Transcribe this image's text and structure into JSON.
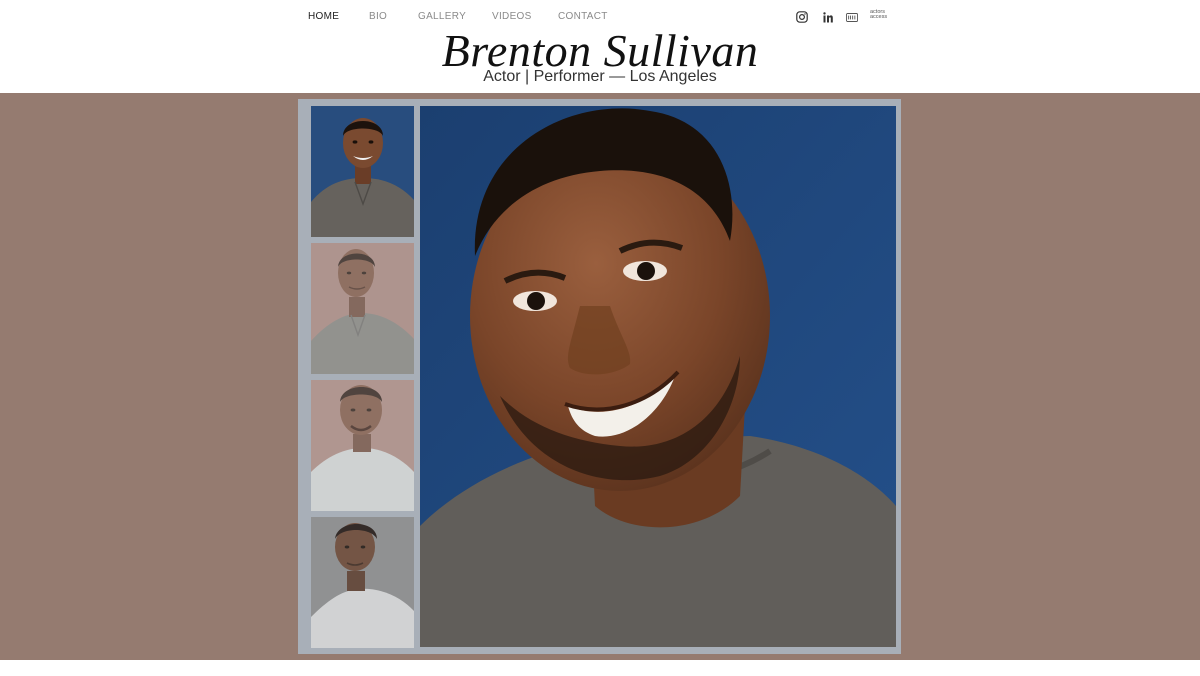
{
  "nav": {
    "items": [
      {
        "label": "HOME",
        "active": true
      },
      {
        "label": "BIO",
        "active": false
      },
      {
        "label": "GALLERY",
        "active": false
      },
      {
        "label": "VIDEOS",
        "active": false
      },
      {
        "label": "CONTACT",
        "active": false
      }
    ],
    "social": [
      {
        "icon": "instagram-icon"
      },
      {
        "icon": "linkedin-icon"
      },
      {
        "icon": "imdb-icon"
      },
      {
        "icon": "actors-access-icon",
        "text": "actors access"
      }
    ]
  },
  "header": {
    "title": "Brenton Sullivan",
    "subtitle": "Actor | Performer — Los Angeles"
  },
  "colors": {
    "band": "#957b70",
    "frame": "#a8afb8",
    "headshot_background": "#1f4678"
  },
  "gallery": {
    "thumbnails": [
      {
        "backdrop": "blue",
        "shirt": "grey henley",
        "selected": true
      },
      {
        "backdrop": "pink",
        "shirt": "grey henley",
        "selected": false
      },
      {
        "backdrop": "pink",
        "shirt": "white tee",
        "selected": false
      },
      {
        "backdrop": "grey",
        "shirt": "white tee",
        "selected": false
      }
    ]
  }
}
